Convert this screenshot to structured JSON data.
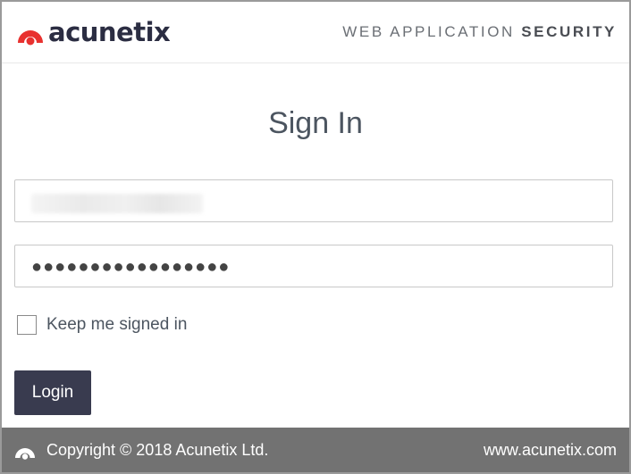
{
  "header": {
    "logo_text": "acunetix",
    "tagline_regular": "WEB APPLICATION ",
    "tagline_bold": "SECURITY"
  },
  "main": {
    "title": "Sign In",
    "username": {
      "value": "",
      "masked": true
    },
    "password": {
      "masked_value": "●●●●●●●●●●●●●●●●●"
    },
    "remember": {
      "label": "Keep me signed in",
      "checked": false
    },
    "login_label": "Login"
  },
  "footer": {
    "copyright": "Copyright © 2018 Acunetix Ltd.",
    "site": "www.acunetix.com"
  },
  "colors": {
    "brand_red": "#e8312f",
    "button_bg": "#393b4f",
    "footer_bg": "#727272"
  },
  "icons": [
    "acunetix-logo-icon",
    "acunetix-footer-icon"
  ]
}
